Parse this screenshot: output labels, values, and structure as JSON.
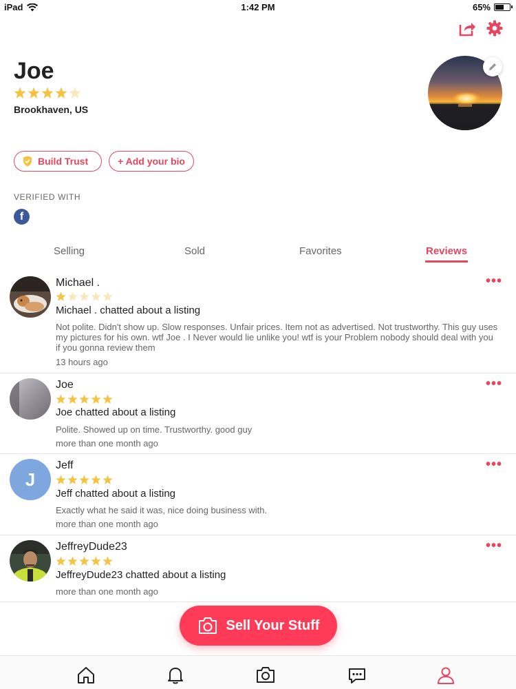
{
  "status_bar": {
    "carrier": "iPad",
    "time": "1:42 PM",
    "battery": "65%",
    "battery_level": 0.65
  },
  "header": {
    "share_icon": "share-icon",
    "settings_icon": "gear-icon"
  },
  "profile": {
    "name": "Joe",
    "rating": 4,
    "location": "Brookhaven, US",
    "build_trust_label": "Build Trust",
    "add_bio_label": "+ Add your bio",
    "verified_with_label": "VERIFIED WITH",
    "verified_icon": "facebook-icon"
  },
  "tabs": [
    {
      "label": "Selling",
      "active": false
    },
    {
      "label": "Sold",
      "active": false
    },
    {
      "label": "Favorites",
      "active": false
    },
    {
      "label": "Reviews",
      "active": true
    }
  ],
  "reviews": [
    {
      "name": "Michael .",
      "rating": 1,
      "headline": "Michael . chatted about a listing",
      "body": "Not polite. Didn't show up. Slow responses. Unfair prices. Item not as advertised. Not trustworthy. This guy uses my pictures for his own. wtf Joe . I Never would lie unlike you! wtf is your Problem nobody should deal with you if you gonna review them",
      "time": "13 hours ago",
      "more": "•••"
    },
    {
      "name": "Joe",
      "rating": 5,
      "headline": "Joe chatted about a listing",
      "body": "Polite. Showed up on time. Trustworthy. good guy",
      "time": "more than one month ago",
      "more": "•••"
    },
    {
      "name": "Jeff",
      "rating": 5,
      "avatar_initial": "J",
      "headline": "Jeff chatted about a listing",
      "body": "Exactly what he said it was, nice doing business with.",
      "time": "more than one month ago",
      "more": "•••"
    },
    {
      "name": "JeffreyDude23",
      "rating": 5,
      "headline": "JeffreyDude23 chatted about a listing",
      "body": "",
      "time": "more than one month ago",
      "more": "•••"
    }
  ],
  "sell_button": {
    "label": "Sell Your Stuff",
    "icon": "camera-icon"
  },
  "tab_bar": {
    "items": [
      {
        "icon": "home-icon",
        "active": false
      },
      {
        "icon": "bell-icon",
        "active": false
      },
      {
        "icon": "camera-icon",
        "active": false
      },
      {
        "icon": "chat-icon",
        "active": false
      },
      {
        "icon": "profile-icon",
        "active": true
      }
    ]
  },
  "colors": {
    "accent": "#e8455e",
    "sell_button": "#ff3b58",
    "star": "#f5c242",
    "star_empty": "#f8e7b8",
    "facebook": "#3b5998",
    "jeff_avatar": "#7ea7e0"
  }
}
